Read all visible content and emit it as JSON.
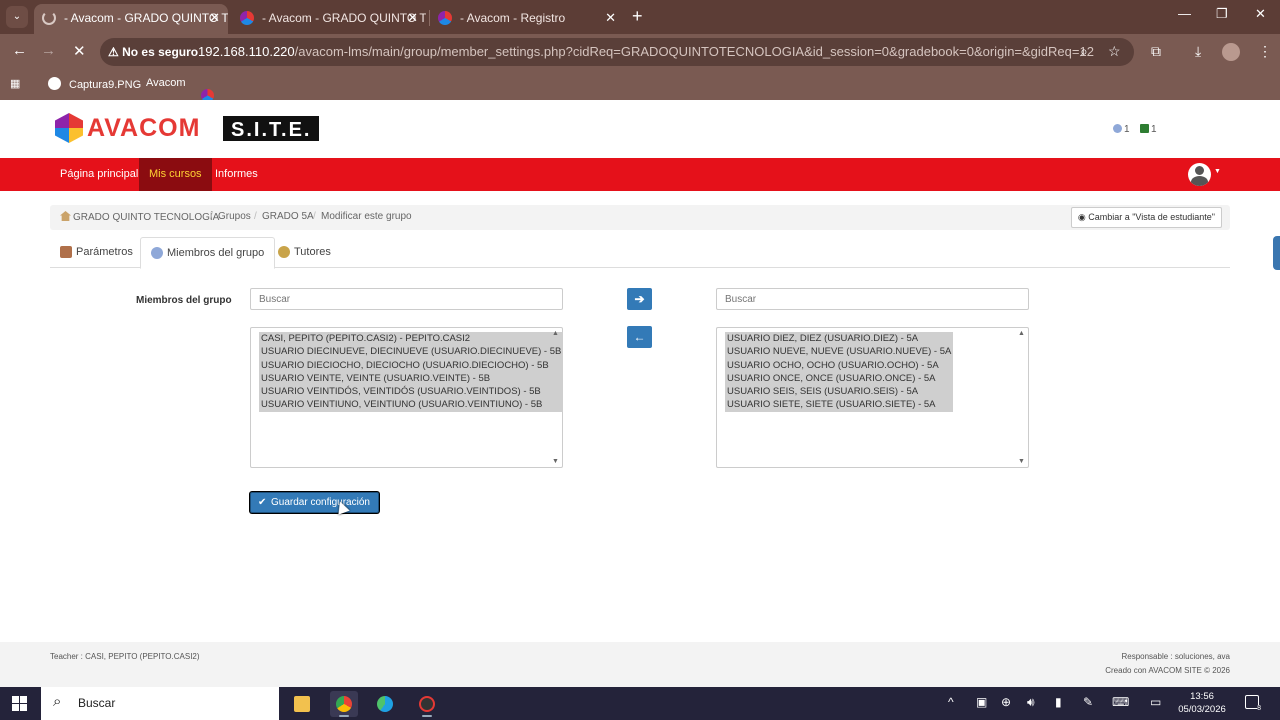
{
  "browser": {
    "tabs": [
      {
        "title": "- Avacom - GRADO QUINTO TE",
        "close": "✕"
      },
      {
        "title": "- Avacom - GRADO QUINTO TE",
        "close": "✕"
      },
      {
        "title": "- Avacom - Registro",
        "close": "✕"
      }
    ],
    "new_tab": "+",
    "security_label": "No es seguro",
    "url_host": "192.168.110.220",
    "url_path": "/avacom-lms/main/group/member_settings.php?cidReq=GRADOQUINTOTECNOLOGIA&id_session=0&gradebook=0&origin=&gidReq=12",
    "bookmarks": [
      {
        "label": "Captura9.PNG"
      },
      {
        "label": "Avacom"
      }
    ]
  },
  "site": {
    "logo_word": "AVACOM",
    "logo_badge": "S.I.T.E.",
    "counter_users": "1",
    "counter_flags": "1"
  },
  "nav": {
    "items": [
      "Página principal",
      "Mis cursos",
      "Informes"
    ]
  },
  "breadcrumb": {
    "items": [
      "GRADO QUINTO TECNOLOGÍA",
      "Grupos",
      "GRADO 5A",
      "Modificar este grupo"
    ],
    "student_view": "Cambiar a \"Vista de estudiante\""
  },
  "tabs": [
    "Parámetros",
    "Miembros del grupo",
    "Tutores"
  ],
  "form": {
    "label": "Miembros del grupo",
    "search_placeholder_left": "Buscar",
    "search_placeholder_right": "Buscar",
    "move_right_icon": "➔",
    "move_left_icon": "←",
    "left_list": [
      "CASI, PEPITO (PEPITO.CASI2) - PEPITO.CASI2",
      "USUARIO DIECINUEVE, DIECINUEVE (USUARIO.DIECINUEVE) - 5B",
      "USUARIO DIECIOCHO, DIECIOCHO (USUARIO.DIECIOCHO) - 5B",
      "USUARIO VEINTE, VEINTE (USUARIO.VEINTE) - 5B",
      "USUARIO VEINTIDÓS, VEINTIDÓS (USUARIO.VEINTIDOS) - 5B",
      "USUARIO VEINTIUNO, VEINTIUNO (USUARIO.VEINTIUNO) - 5B"
    ],
    "right_list": [
      "USUARIO DIEZ, DIEZ (USUARIO.DIEZ) - 5A",
      "USUARIO NUEVE, NUEVE (USUARIO.NUEVE) - 5A",
      "USUARIO OCHO, OCHO (USUARIO.OCHO) - 5A",
      "USUARIO ONCE, ONCE (USUARIO.ONCE) - 5A",
      "USUARIO SEIS, SEIS (USUARIO.SEIS) - 5A",
      "USUARIO SIETE, SIETE (USUARIO.SIETE) - 5A"
    ],
    "save_label": "Guardar configuración"
  },
  "footer": {
    "teacher": "Teacher : CASI, PEPITO (PEPITO.CASI2)",
    "responsible": "Responsable : soluciones, ava",
    "created": "Creado con AVACOM SITE © 2026"
  },
  "taskbar": {
    "search_label": "Buscar",
    "time": "13:56",
    "date": "05/03/2026",
    "notifications": "8"
  },
  "colors": {
    "navbar": "#e5111a",
    "navbar_active": "#8b0c10",
    "primary_button": "#337ab7",
    "browser_frame": "#7a5a52"
  }
}
